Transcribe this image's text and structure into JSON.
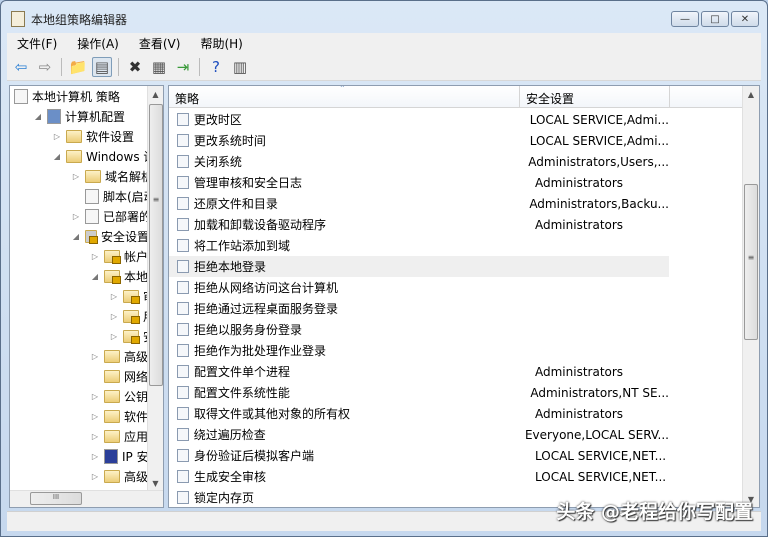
{
  "window": {
    "title": "本地组策略编辑器",
    "min": "—",
    "max": "□",
    "close": "✕"
  },
  "menu": [
    "文件(F)",
    "操作(A)",
    "查看(V)",
    "帮助(H)"
  ],
  "toolbar": [
    {
      "name": "back",
      "glyph": "⇦"
    },
    {
      "name": "forward",
      "glyph": "⇨"
    },
    {
      "name": "up-folder",
      "glyph": "📁"
    },
    {
      "name": "show-hide-tree",
      "glyph": "▤"
    },
    {
      "name": "delete",
      "glyph": "✖"
    },
    {
      "name": "properties",
      "glyph": "▦"
    },
    {
      "name": "export",
      "glyph": "⇥"
    },
    {
      "name": "help",
      "glyph": "?"
    },
    {
      "name": "action-pane",
      "glyph": "▥"
    }
  ],
  "tree": [
    {
      "label": "本地计算机 策略",
      "level": 0,
      "arrow": "",
      "icon": "doc"
    },
    {
      "label": "计算机配置",
      "level": 1,
      "arrow": "◢",
      "icon": "computer"
    },
    {
      "label": "软件设置",
      "level": 2,
      "arrow": "▷",
      "icon": "folder"
    },
    {
      "label": "Windows 设置",
      "level": 2,
      "arrow": "◢",
      "icon": "folder"
    },
    {
      "label": "域名解析策略",
      "level": 3,
      "arrow": "▷",
      "icon": "folder"
    },
    {
      "label": "脚本(启动/关机)",
      "level": 3,
      "arrow": "",
      "icon": "doc"
    },
    {
      "label": "已部署的打印机",
      "level": 3,
      "arrow": "▷",
      "icon": "printer"
    },
    {
      "label": "安全设置",
      "level": 3,
      "arrow": "◢",
      "icon": "lock"
    },
    {
      "label": "帐户策略",
      "level": 4,
      "arrow": "▷",
      "icon": "lockfolder"
    },
    {
      "label": "本地策略",
      "level": 4,
      "arrow": "◢",
      "icon": "lockfolder"
    },
    {
      "label": "审核策略",
      "level": 5,
      "arrow": "▷",
      "icon": "lockfolder"
    },
    {
      "label": "用户权限分配",
      "level": 5,
      "arrow": "▷",
      "icon": "lockfolder"
    },
    {
      "label": "安全选项",
      "level": 5,
      "arrow": "▷",
      "icon": "lockfolder"
    },
    {
      "label": "高级安全",
      "level": 4,
      "arrow": "▷",
      "icon": "folder"
    },
    {
      "label": "网络列表",
      "level": 4,
      "arrow": "",
      "icon": "folder"
    },
    {
      "label": "公钥策略",
      "level": 4,
      "arrow": "▷",
      "icon": "folder"
    },
    {
      "label": "软件限制",
      "level": 4,
      "arrow": "▷",
      "icon": "folder"
    },
    {
      "label": "应用程序",
      "level": 4,
      "arrow": "▷",
      "icon": "folder"
    },
    {
      "label": "IP 安全策略",
      "level": 4,
      "arrow": "▷",
      "icon": "ip"
    },
    {
      "label": "高级审核",
      "level": 4,
      "arrow": "▷",
      "icon": "folder"
    }
  ],
  "list": {
    "columns": [
      "策略",
      "安全设置"
    ],
    "rows": [
      {
        "policy": "更改时区",
        "setting": "LOCAL SERVICE,Admi..."
      },
      {
        "policy": "更改系统时间",
        "setting": "LOCAL SERVICE,Admi..."
      },
      {
        "policy": "关闭系统",
        "setting": "Administrators,Users,..."
      },
      {
        "policy": "管理审核和安全日志",
        "setting": "Administrators"
      },
      {
        "policy": "还原文件和目录",
        "setting": "Administrators,Backu..."
      },
      {
        "policy": "加载和卸载设备驱动程序",
        "setting": "Administrators"
      },
      {
        "policy": "将工作站添加到域",
        "setting": ""
      },
      {
        "policy": "拒绝本地登录",
        "setting": "",
        "selected": true
      },
      {
        "policy": "拒绝从网络访问这台计算机",
        "setting": ""
      },
      {
        "policy": "拒绝通过远程桌面服务登录",
        "setting": ""
      },
      {
        "policy": "拒绝以服务身份登录",
        "setting": ""
      },
      {
        "policy": "拒绝作为批处理作业登录",
        "setting": ""
      },
      {
        "policy": "配置文件单个进程",
        "setting": "Administrators"
      },
      {
        "policy": "配置文件系统性能",
        "setting": "Administrators,NT SE..."
      },
      {
        "policy": "取得文件或其他对象的所有权",
        "setting": "Administrators"
      },
      {
        "policy": "绕过遍历检查",
        "setting": "Everyone,LOCAL SERV..."
      },
      {
        "policy": "身份验证后模拟客户端",
        "setting": "LOCAL SERVICE,NET..."
      },
      {
        "policy": "生成安全审核",
        "setting": "LOCAL SERVICE,NET..."
      },
      {
        "policy": "锁定内存页",
        "setting": ""
      }
    ]
  },
  "watermark": "头条 @老程给你写配置"
}
